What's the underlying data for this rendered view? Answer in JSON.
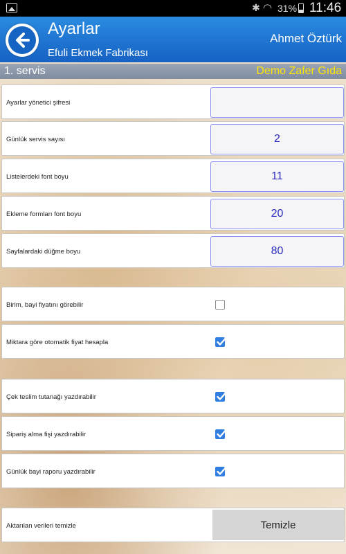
{
  "status_bar": {
    "battery_percent": "31%",
    "clock": "11:46"
  },
  "header": {
    "title": "Ayarlar",
    "subtitle": "Efuli Ekmek Fabrikası",
    "user": "Ahmet Öztürk",
    "back_icon": "back-arrow-icon"
  },
  "section": {
    "title": "1. servis",
    "company": "Demo Zafer Gıda"
  },
  "settings": {
    "admin_password": {
      "label": "Ayarlar yönetici şifresi",
      "value": ""
    },
    "daily_service_count": {
      "label": "Günlük servis sayısı",
      "value": "2"
    },
    "list_font_size": {
      "label": "Listelerdeki font boyu",
      "value": "11"
    },
    "form_font_size": {
      "label": "Ekleme formları font boyu",
      "value": "20"
    },
    "button_size": {
      "label": "Sayfalardaki düğme boyu",
      "value": "80"
    }
  },
  "checkboxes": {
    "show_dealer_price": {
      "label": "Birim, bayi fiyatını görebilir",
      "checked": false
    },
    "auto_price": {
      "label": "Miktara göre otomatik fiyat hesapla",
      "checked": true
    },
    "print_delivery_report": {
      "label": "Çek teslim tutanağı yazdırabilir",
      "checked": true
    },
    "print_order_receipt": {
      "label": "Sipariş alma fişi yazdırabilir",
      "checked": true
    },
    "print_daily_dealer_report": {
      "label": "Günlük bayi raporu yazdırabilir",
      "checked": true
    }
  },
  "clear_data": {
    "label": "Aktarılan verileri temizle",
    "button": "Temizle"
  },
  "colors": {
    "header": "#1a6fd0",
    "company_text": "#ffe600",
    "value_text": "#2b2bc0",
    "checkbox_checked": "#2f7ee0"
  }
}
